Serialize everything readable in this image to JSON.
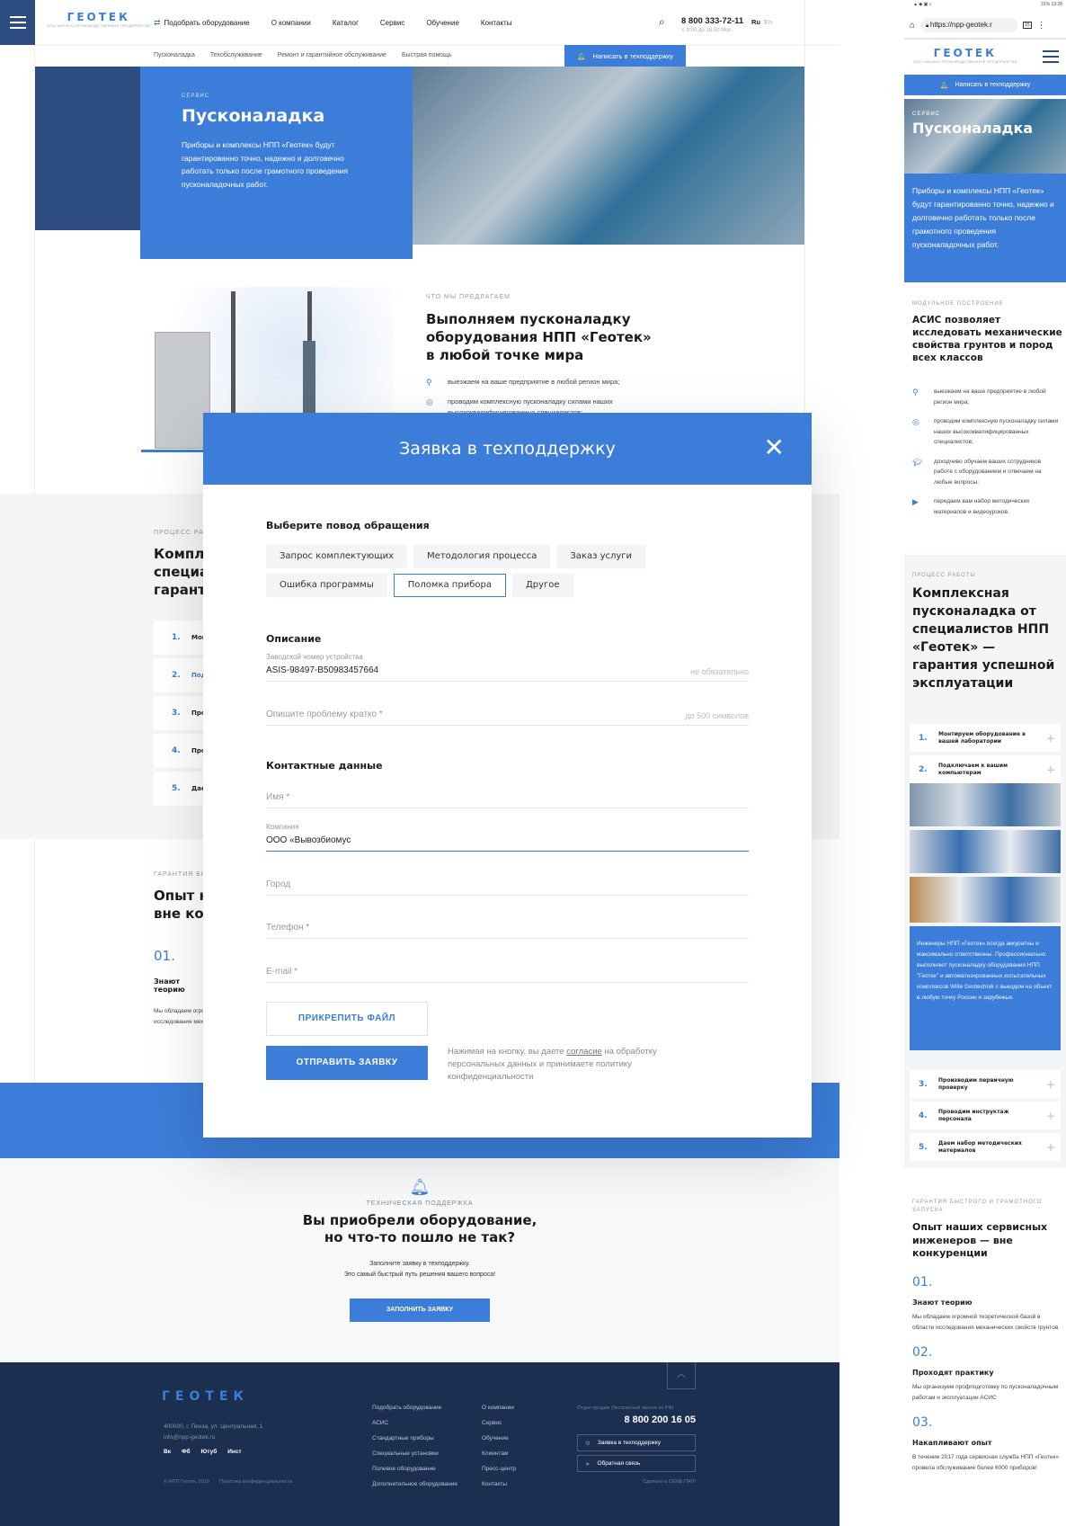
{
  "header": {
    "nav": [
      "Подобрать оборудование",
      "О компании",
      "Каталог",
      "Сервис",
      "Обучение",
      "Контакты"
    ],
    "active_nav": "Сервис",
    "phone": "8 800 333-72-11",
    "hours": "с 9:00 до 18:00 Мск",
    "lang_ru": "Ru",
    "lang_en": "En",
    "logo": "ГЕОТЕК",
    "logo_sub": "ООО НАУЧНО-ПРОИЗВОДСТВЕННОЕ ПРЕДПРИЯТИЕ"
  },
  "subnav": {
    "items": [
      "Пусконаладка",
      "Техобслуживание",
      "Ремонт и гарантийное обслуживание",
      "Быстрая помощь"
    ],
    "support_button": "Написать в техподдержку"
  },
  "hero": {
    "label": "СЕРВИС",
    "title": "Пусконаладка",
    "text": "Приборы и комплексы НПП «Геотек» будут гарантированно точно, надежно и долговечно работать только после грамотного проведения пусконаладочных работ."
  },
  "offer": {
    "label": "ЧТО МЫ ПРЕДЛАГАЕМ",
    "title": "Выполняем пусконаладку оборудования НПП «Геотек» в любой точке мира",
    "items": [
      "выезжаем на ваше предприятие в любой регион мира;",
      "проводим комплексную пусконаладку силами наших высококвалифицированных специалистов;"
    ]
  },
  "process": {
    "label": "ПРОЦЕСС РАБОТЫ",
    "title": "Комплексная пусконаладка от специалистов НПП «Геотек» — гарантия успешной эксплуатации",
    "steps": [
      {
        "n": "1.",
        "t": "Монтируем оборудование в вашей лаборатории"
      },
      {
        "n": "2.",
        "t": "Подключаем к вашим компьютерам"
      },
      {
        "n": "3.",
        "t": "Производим первичную проверку"
      },
      {
        "n": "4.",
        "t": "Проводим инструктаж персонала"
      },
      {
        "n": "5.",
        "t": "Даем набор методических материалов"
      }
    ],
    "note": "Инженеры НПП «Геотек» всегда аккуратны и максимально ответственны. Профессионально выполняют пусконаладку оборудования НПП \"Геотек\" и автоматизированных испытательных комплексов Wille Geotechnik с выездом на объект в любую точку России и зарубежья."
  },
  "guarantee": {
    "label": "ГАРАНТИЯ БЫСТРОГО И ГРАМОТНОГО ЗАПУСКА",
    "title": "Опыт наших сервисных инженеров — вне конкуренции",
    "items": [
      {
        "n": "01.",
        "t": "Знают теорию",
        "d": "Мы обладаем огромной теоретической базой в области исследования механических свойств грунтов"
      },
      {
        "n": "02.",
        "t": "Проходят практику",
        "d": "Мы организуем профподготовку по пусконаладочным работам и эксплуатации АСИС"
      },
      {
        "n": "03.",
        "t": "Накапливают опыт",
        "d": "В течение 2017 года сервисная служба НПП «Геотек» провела обслуживание более 6000 приборов!"
      }
    ]
  },
  "support": {
    "label": "ТЕХНИЧЕСКАЯ ПОДДЕРЖКА",
    "title": "Вы приобрели оборудование, но что-то пошло не так?",
    "line1": "Заполните заявку в техподдержку.",
    "line2": "Это самый быстрый путь решения вашего вопроса!",
    "button": "ЗАПОЛНИТЬ ЗАЯВКУ"
  },
  "footer": {
    "address": "400000, г. Пенза, ул. Центральная, 1",
    "email": "info@npp-geotek.ru",
    "social": [
      "Вк",
      "Фб",
      "Ютуб",
      "Инст"
    ],
    "copyright": "© НПП Геотек, 2019",
    "privacy": "Политика конфиденциальности",
    "col1": [
      "Подобрать оборудование",
      "АСИС",
      "Стандартные приборы",
      "Специальные установки",
      "Полевое оборудование",
      "Дополнительное оборудование"
    ],
    "col2": [
      "О компании",
      "Сервис",
      "Обучение",
      "Клиентам",
      "Пресс-центр",
      "Контакты"
    ],
    "sales_label": "Отдел продаж (бесплатный звонок по РФ)",
    "phone": "8 800 200 16 05",
    "support_btn": "Заявка в техподдержку",
    "feedback_btn": "Обратная связь",
    "made_by": "Сделано в СЕМЬ ПАП!"
  },
  "modal": {
    "title": "Заявка в техподдержку",
    "reason_title": "Выберите повод обращения",
    "reasons": [
      "Запрос комплектующих",
      "Методология процесса",
      "Заказ услуги",
      "Ошибка программы",
      "Поломка прибора",
      "Другое"
    ],
    "selected_reason": "Поломка прибора",
    "desc_title": "Описание",
    "serial_label": "Заводской номер устройства",
    "serial_value": "ASIS-98497-B50983457664",
    "serial_hint": "не обязательно",
    "problem_placeholder": "Опишите проблему кратко *",
    "problem_hint": "до 500 символов",
    "contact_title": "Контактные данные",
    "name_placeholder": "Имя *",
    "company_label": "Компания",
    "company_value": "ООО «Вывозбиомус",
    "city_placeholder": "Город",
    "phone_placeholder": "Телефон *",
    "email_placeholder": "E-mail *",
    "attach": "ПРИКРЕПИТЬ ФАЙЛ",
    "submit": "ОТПРАВИТЬ ЗАЯВКУ",
    "consent_pre": "Нажимая на кнопку, вы даете ",
    "consent_link": "согласие",
    "consent_post": " на обработку персональных данных и принимаете политику конфиденциальности"
  },
  "mobile": {
    "status_left": "▲ ◆ ▣ ⌕",
    "status_right": "31% 13:28",
    "url": "https://npp-geotek.r",
    "tabs": "15",
    "modular_label": "МОДУЛЬНОЕ ПОСТРОЕНИЕ",
    "modular_title": "АСИС позволяет исследовать механические свойства грунтов и пород всех классов",
    "modular_items": [
      "выезжаем на ваше предприятие в любой регион мира;",
      "проводим комплексную пусконаладку силами наших высококвалифицированных специалистов;",
      "доходчиво обучаем ваших сотрудников работе с оборудованием и отвечаем на любые вопросы;",
      "передаем вам набор методических материалов и видеоуроков."
    ]
  }
}
